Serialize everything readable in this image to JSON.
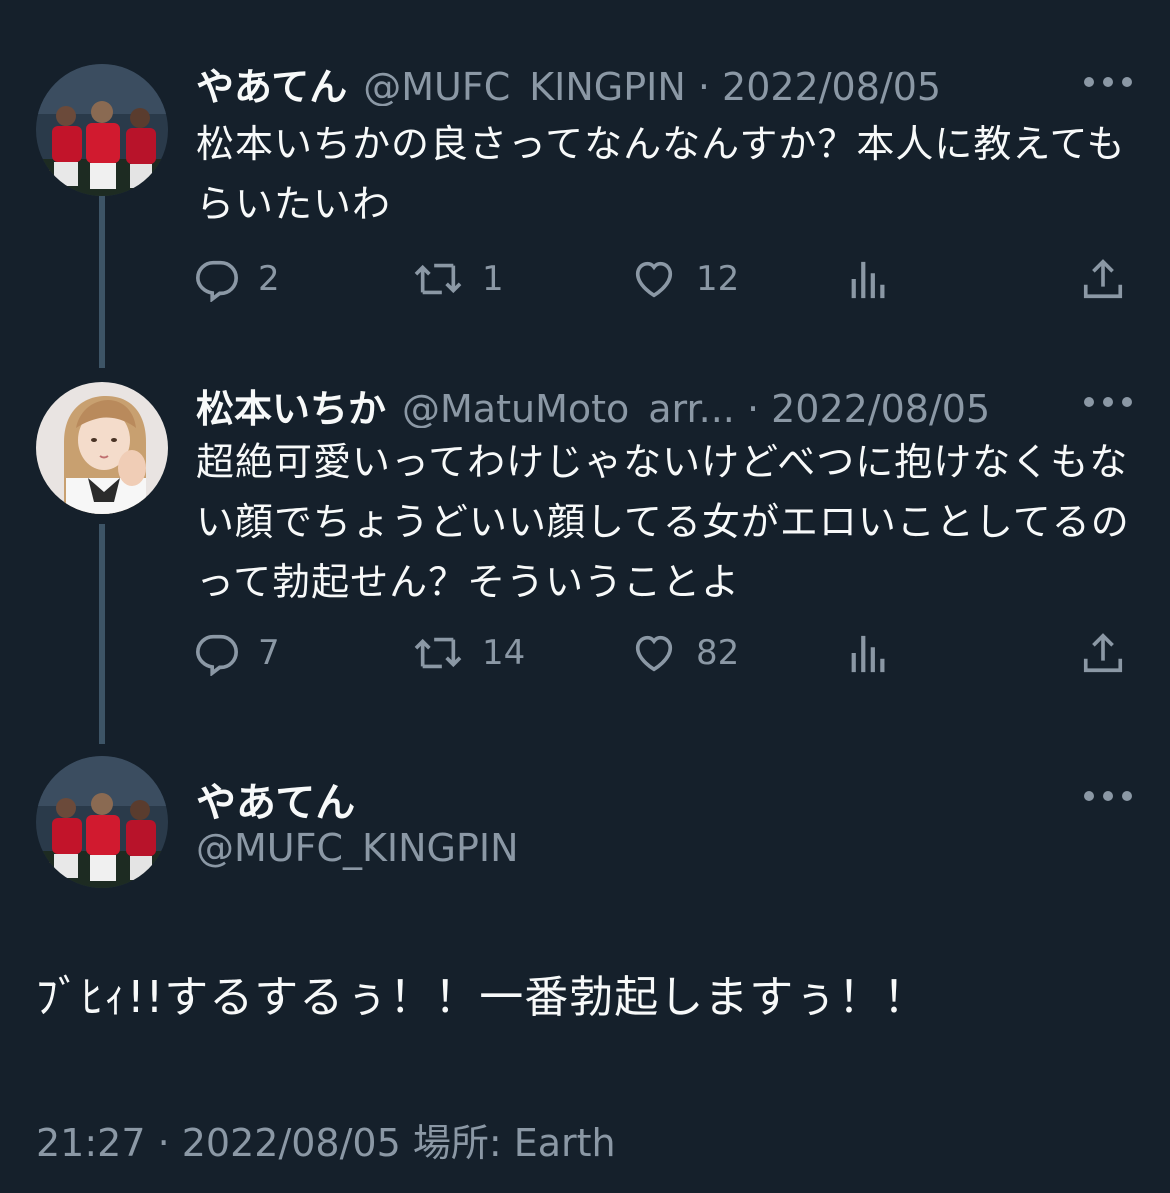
{
  "tweets": [
    {
      "name": "やあてん",
      "handle_date": "@MUFC_KINGPIN · 2022/08/05",
      "text": "松本いちかの良さってなんなんすか？本人に教えてもらいたいわ",
      "avatar": "football-team-photo",
      "stats": {
        "replies": "2",
        "retweets": "1",
        "likes": "12"
      }
    },
    {
      "name": "松本いちか",
      "handle_date": "@MatuMoto_arr... · 2022/08/05",
      "text": "超絶可愛いってわけじゃないけどべつに抱けなくもない顔でちょうどいい顔してる女がエロいことしてるのって勃起せん？そういうことよ",
      "avatar": "woman-portrait-photo",
      "stats": {
        "replies": "7",
        "retweets": "14",
        "likes": "82"
      }
    }
  ],
  "main_tweet": {
    "name": "やあてん",
    "handle": "@MUFC_KINGPIN",
    "text": "ﾌﾞﾋｨ!!するするぅ！！一番勃起しますぅ！！",
    "footer": "21:27 · 2022/08/05 場所: Earth",
    "avatar": "football-team-photo"
  },
  "icons": {
    "reply": "reply-icon",
    "retweet": "retweet-icon",
    "like": "heart-icon",
    "views": "analytics-icon",
    "share": "share-icon",
    "more": "more-icon"
  },
  "colors": {
    "background": "#15202b",
    "primary_text": "#f7f9f9",
    "secondary_text": "#8b98a5",
    "thread_line": "#3d5466"
  }
}
